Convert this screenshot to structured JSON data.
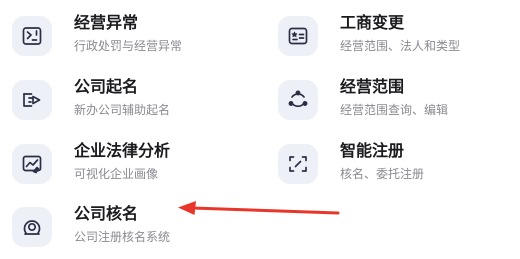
{
  "services": [
    {
      "title": "经营异常",
      "subtitle": "行政处罚与经营异常",
      "icon": "notice-report-icon"
    },
    {
      "title": "工商变更",
      "subtitle": "经营范围、法人和类型",
      "icon": "change-card-icon"
    },
    {
      "title": "公司起名",
      "subtitle": "新办公司辅助起名",
      "icon": "tag-pencil-icon"
    },
    {
      "title": "经营范围",
      "subtitle": "经营范围查询、编辑",
      "icon": "scope-circle-icon"
    },
    {
      "title": "企业法律分析",
      "subtitle": "可视化企业画像",
      "icon": "chart-analysis-icon"
    },
    {
      "title": "智能注册",
      "subtitle": "核名、委托注册",
      "icon": "scan-frame-icon"
    },
    {
      "title": "公司核名",
      "subtitle": "公司注册核名系统",
      "icon": "name-check-icon"
    }
  ],
  "annotation": {
    "arrow_color": "#e8362b"
  }
}
